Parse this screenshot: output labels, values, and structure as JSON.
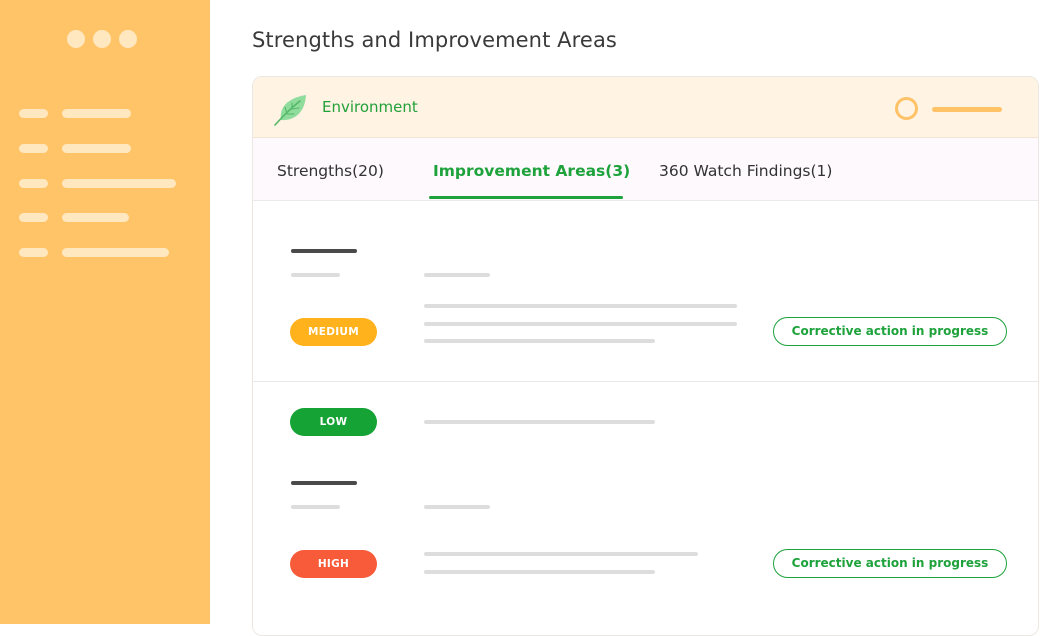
{
  "page": {
    "title": "Strengths and Improvement Areas"
  },
  "card": {
    "category": "Environment",
    "category_icon": "leaf-icon"
  },
  "tabs": [
    {
      "label": "Strengths(20)",
      "active": false
    },
    {
      "label": "Improvement Areas(3)",
      "active": true
    },
    {
      "label": "360 Watch Findings(1)",
      "active": false
    }
  ],
  "findings": [
    {
      "severity": "MEDIUM",
      "action": "Corrective action in progress"
    },
    {
      "severity": "LOW"
    },
    {
      "severity": "HIGH",
      "action": "Corrective action in progress"
    }
  ],
  "colors": {
    "sidebar": "#ffc467",
    "accent_green": "#1ea23c",
    "medium": "#ffb21c",
    "low": "#16a336",
    "high": "#f75b3a"
  }
}
